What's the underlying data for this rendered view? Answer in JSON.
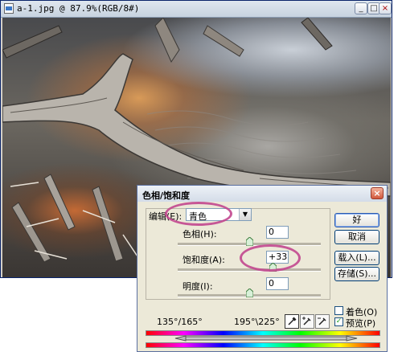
{
  "document": {
    "title": "a-1.jpg @ 87.9%(RGB/8#)"
  },
  "dialog": {
    "title": "色相/饱和度",
    "edit_label": "编辑(E):",
    "edit_value": "青色",
    "hue_label": "色相(H):",
    "hue_value": "0",
    "saturation_label": "饱和度(A):",
    "saturation_value": "+33",
    "lightness_label": "明度(I):",
    "lightness_value": "0",
    "buttons": {
      "ok": "好",
      "cancel": "取消",
      "load": "载入(L)...",
      "save": "存储(S)..."
    },
    "colorize_label": "着色(O)",
    "preview_label": "预览(P)",
    "colorize_checked": false,
    "preview_checked": true,
    "range_left": "135°/165°",
    "range_right": "195°\\225°",
    "sliders": {
      "hue": 0,
      "saturation": 33,
      "lightness": 0
    },
    "highlight_color": "#c2478f"
  }
}
